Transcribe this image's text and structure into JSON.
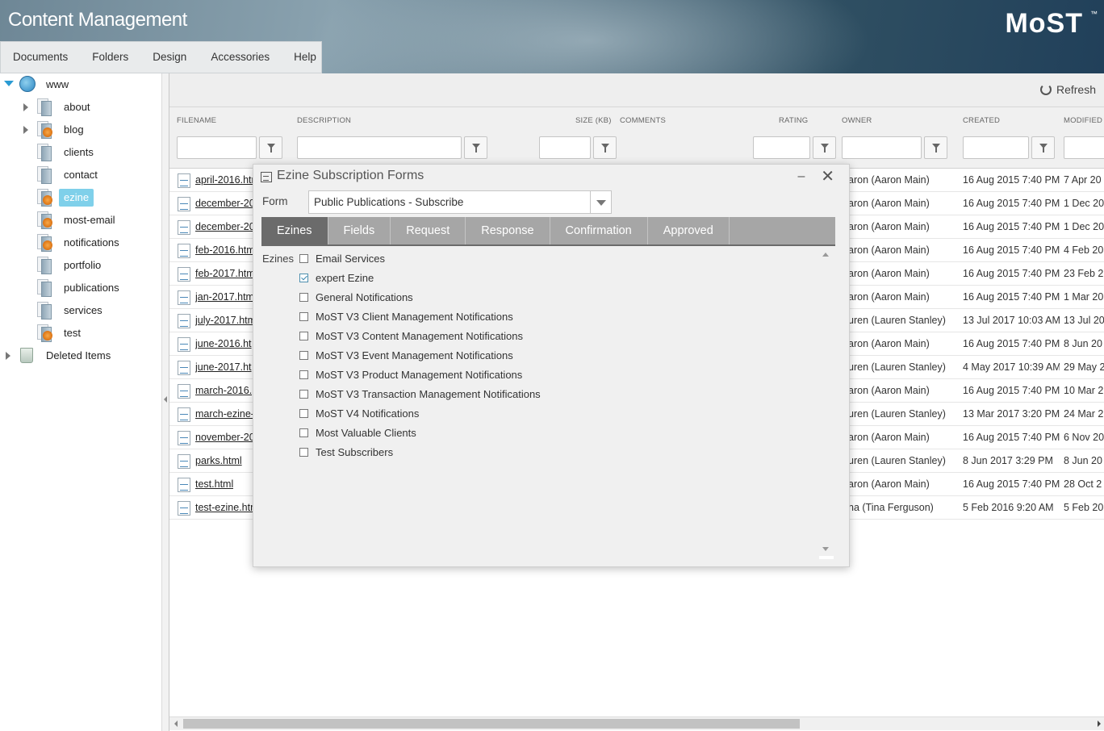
{
  "header": {
    "title": "Content Management",
    "logo": "MoST",
    "logo_tm": "™"
  },
  "menu": [
    "Documents",
    "Folders",
    "Design",
    "Accessories",
    "Help"
  ],
  "tree": {
    "root": "www",
    "folders": [
      "about",
      "blog",
      "clients",
      "contact",
      "ezine",
      "most-email",
      "notifications",
      "portfolio",
      "publications",
      "services",
      "test"
    ],
    "selected": "ezine",
    "deleted": "Deleted Items"
  },
  "toolbar": {
    "refresh": "Refresh"
  },
  "columns": [
    "FILENAME",
    "DESCRIPTION",
    "SIZE (KB)",
    "COMMENTS",
    "RATING",
    "OWNER",
    "CREATED",
    "MODIFIED"
  ],
  "rows": [
    {
      "file": "april-2016.htm",
      "owner": "aron (Aaron Main)",
      "created": "16 Aug 2015 7:40 PM",
      "modified": "7 Apr 20"
    },
    {
      "file": "december-20",
      "owner": "aron (Aaron Main)",
      "created": "16 Aug 2015 7:40 PM",
      "modified": "1 Dec 20"
    },
    {
      "file": "december-20",
      "owner": "aron (Aaron Main)",
      "created": "16 Aug 2015 7:40 PM",
      "modified": "1 Dec 20"
    },
    {
      "file": "feb-2016.htm",
      "owner": "aron (Aaron Main)",
      "created": "16 Aug 2015 7:40 PM",
      "modified": "4 Feb 20"
    },
    {
      "file": "feb-2017.htm",
      "owner": "aron (Aaron Main)",
      "created": "16 Aug 2015 7:40 PM",
      "modified": "23 Feb 2"
    },
    {
      "file": "jan-2017.htm",
      "owner": "aron (Aaron Main)",
      "created": "16 Aug 2015 7:40 PM",
      "modified": "1 Mar 20"
    },
    {
      "file": "july-2017.htm",
      "owner": "uren (Lauren Stanley)",
      "created": "13 Jul 2017 10:03 AM",
      "modified": "13 Jul 20"
    },
    {
      "file": "june-2016.ht",
      "owner": "aron (Aaron Main)",
      "created": "16 Aug 2015 7:40 PM",
      "modified": "8 Jun 20"
    },
    {
      "file": "june-2017.ht",
      "owner": "uren (Lauren Stanley)",
      "created": "4 May 2017 10:39 AM",
      "modified": "29 May 2"
    },
    {
      "file": "march-2016.",
      "owner": "aron (Aaron Main)",
      "created": "16 Aug 2015 7:40 PM",
      "modified": "10 Mar 2"
    },
    {
      "file": "march-ezine-",
      "owner": "uren (Lauren Stanley)",
      "created": "13 Mar 2017 3:20 PM",
      "modified": "24 Mar 2"
    },
    {
      "file": "november-20",
      "owner": "aron (Aaron Main)",
      "created": "16 Aug 2015 7:40 PM",
      "modified": "6 Nov 20"
    },
    {
      "file": "parks.html",
      "owner": "uren (Lauren Stanley)",
      "created": "8 Jun 2017 3:29 PM",
      "modified": "8 Jun 20"
    },
    {
      "file": "test.html",
      "owner": "aron (Aaron Main)",
      "created": "16 Aug 2015 7:40 PM",
      "modified": "28 Oct 2"
    },
    {
      "file": "test-ezine.htm",
      "owner": "na (Tina Ferguson)",
      "created": "5 Feb 2016 9:20 AM",
      "modified": "5 Feb 20"
    }
  ],
  "dialog": {
    "title": "Ezine Subscription Forms",
    "form_label": "Form",
    "form_value": "Public Publications - Subscribe",
    "tabs": [
      "Ezines",
      "Fields",
      "Request",
      "Response",
      "Confirmation",
      "Approved"
    ],
    "active_tab": "Ezines",
    "ezines_label": "Ezines",
    "ezines": [
      {
        "name": "Email Services",
        "checked": false
      },
      {
        "name": "expert Ezine",
        "checked": true
      },
      {
        "name": "General Notifications",
        "checked": false
      },
      {
        "name": "MoST V3 Client Management Notifications",
        "checked": false
      },
      {
        "name": "MoST V3 Content Management Notifications",
        "checked": false
      },
      {
        "name": "MoST V3 Event Management Notifications",
        "checked": false
      },
      {
        "name": "MoST V3 Product Management Notifications",
        "checked": false
      },
      {
        "name": "MoST V3 Transaction Management Notifications",
        "checked": false
      },
      {
        "name": "MoST V4 Notifications",
        "checked": false
      },
      {
        "name": "Most Valuable Clients",
        "checked": false
      },
      {
        "name": "Test Subscribers",
        "checked": false
      }
    ]
  }
}
